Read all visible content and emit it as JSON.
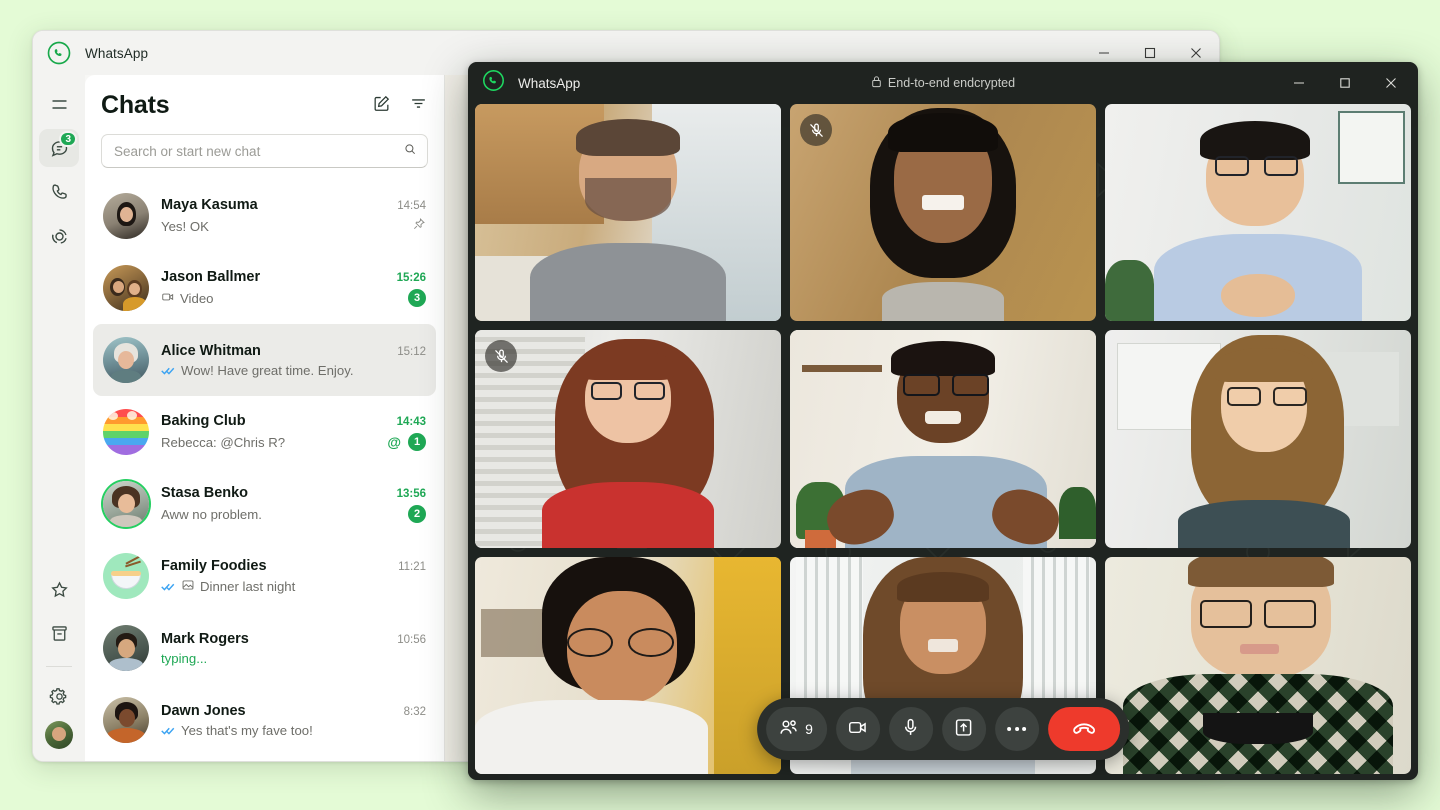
{
  "desktop": {
    "background_color": "#e4fbd6"
  },
  "main_window": {
    "app_name": "WhatsApp",
    "window_controls": {
      "minimize": "minimize-icon",
      "maximize": "maximize-icon",
      "close": "close-icon"
    },
    "rail": {
      "items": [
        {
          "name": "menu",
          "icon": "hamburger-menu-icon",
          "badge": ""
        },
        {
          "name": "chats",
          "icon": "chats-icon",
          "badge": "3",
          "active": true
        },
        {
          "name": "calls",
          "icon": "phone-icon",
          "badge": ""
        },
        {
          "name": "status",
          "icon": "status-circle-icon",
          "badge": ""
        },
        {
          "name": "starred",
          "icon": "star-icon",
          "badge": ""
        },
        {
          "name": "archived",
          "icon": "archive-icon",
          "badge": ""
        },
        {
          "name": "settings",
          "icon": "gear-icon",
          "badge": ""
        },
        {
          "name": "profile",
          "icon": "avatar",
          "badge": ""
        }
      ]
    },
    "chats_panel": {
      "title": "Chats",
      "new_chat_icon": "compose-icon",
      "filter_icon": "filter-icon",
      "search": {
        "placeholder": "Search or start new chat",
        "value": "",
        "icon": "search-icon"
      },
      "items": [
        {
          "name": "Maya Kasuma",
          "message": "Yes! OK",
          "time": "14:54",
          "unread": "",
          "selected": false,
          "ticks": false,
          "prefix_icon": "",
          "pinned": true,
          "mention": false,
          "typing": false,
          "ring": false,
          "time_unread": false
        },
        {
          "name": "Jason Ballmer",
          "message": "Video",
          "time": "15:26",
          "unread": "3",
          "selected": false,
          "ticks": false,
          "prefix_icon": "video-icon",
          "pinned": false,
          "mention": false,
          "typing": false,
          "ring": false,
          "time_unread": true
        },
        {
          "name": "Alice Whitman",
          "message": "Wow! Have great time. Enjoy.",
          "time": "15:12",
          "unread": "",
          "selected": true,
          "ticks": true,
          "prefix_icon": "",
          "pinned": false,
          "mention": false,
          "typing": false,
          "ring": false,
          "time_unread": false
        },
        {
          "name": "Baking Club",
          "message": "Rebecca: @Chris R?",
          "time": "14:43",
          "unread": "1",
          "selected": false,
          "ticks": false,
          "prefix_icon": "",
          "pinned": false,
          "mention": true,
          "typing": false,
          "ring": false,
          "time_unread": true
        },
        {
          "name": "Stasa Benko",
          "message": "Aww no problem.",
          "time": "13:56",
          "unread": "2",
          "selected": false,
          "ticks": false,
          "prefix_icon": "",
          "pinned": false,
          "mention": false,
          "typing": false,
          "ring": true,
          "time_unread": true
        },
        {
          "name": "Family Foodies",
          "message": "Dinner last night",
          "time": "11:21",
          "unread": "",
          "selected": false,
          "ticks": true,
          "prefix_icon": "image-icon",
          "pinned": false,
          "mention": false,
          "typing": false,
          "ring": false,
          "time_unread": false
        },
        {
          "name": "Mark Rogers",
          "message": "typing...",
          "time": "10:56",
          "unread": "",
          "selected": false,
          "ticks": false,
          "prefix_icon": "",
          "pinned": false,
          "mention": false,
          "typing": true,
          "ring": false,
          "time_unread": false
        },
        {
          "name": "Dawn Jones",
          "message": "Yes that's my fave too!",
          "time": "8:32",
          "unread": "",
          "selected": false,
          "ticks": true,
          "prefix_icon": "",
          "pinned": false,
          "mention": false,
          "typing": false,
          "ring": false,
          "time_unread": false
        }
      ]
    }
  },
  "call_window": {
    "app_name": "WhatsApp",
    "encryption_label": "End-to-end endcrypted",
    "encryption_icon": "lock-icon",
    "window_controls": {
      "minimize": "minimize-icon",
      "maximize": "maximize-icon",
      "close": "close-icon"
    },
    "participants": [
      {
        "position": 1,
        "muted": false,
        "speaking": false
      },
      {
        "position": 2,
        "muted": true,
        "speaking": false
      },
      {
        "position": 3,
        "muted": false,
        "speaking": false
      },
      {
        "position": 4,
        "muted": true,
        "speaking": false
      },
      {
        "position": 5,
        "muted": false,
        "speaking": true
      },
      {
        "position": 6,
        "muted": false,
        "speaking": false
      },
      {
        "position": 7,
        "muted": false,
        "speaking": false
      },
      {
        "position": 8,
        "muted": false,
        "speaking": false
      },
      {
        "position": 9,
        "muted": false,
        "speaking": false
      }
    ],
    "controls": {
      "participants_count": "9",
      "participants_icon": "people-icon",
      "camera_icon": "video-camera-icon",
      "mic_icon": "microphone-icon",
      "share_screen_icon": "share-screen-icon",
      "more_icon": "more-options-icon",
      "hangup_icon": "end-call-icon",
      "hangup_color": "#ee3a2c"
    }
  },
  "colors": {
    "brand_green": "#1fa855",
    "unread_badge": "#1fa855",
    "tick_blue": "#3ba3f2",
    "call_bg": "#1f2421"
  }
}
